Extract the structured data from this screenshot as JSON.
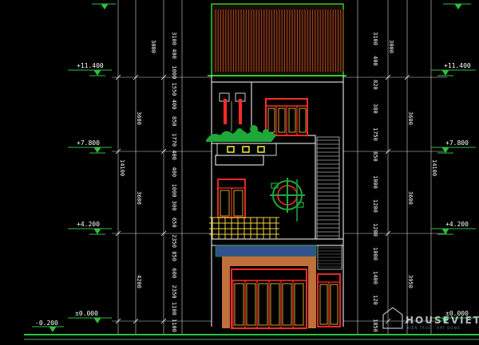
{
  "colors": {
    "background": "#000000",
    "level_line": "#2fbf3f",
    "dimension_line": "#cfcfcf",
    "wall": "#ffffff",
    "roof": "#b0431f",
    "door_frame": "#ff2a2a",
    "door_glass": "#ffcf3a",
    "brick_panel": "#c0703a",
    "stone_panel": "#3b5fa6",
    "railing": "#f2d23a",
    "planter": "#1fa83a"
  },
  "levels": {
    "left": [
      "+11.400",
      "+7.800",
      "+4.200",
      "±0.000",
      "-0.200"
    ],
    "right": [
      "+11.400",
      "+7.800",
      "+4.200",
      "±0.000"
    ]
  },
  "dims": {
    "left_outer_upper": "3000",
    "left_outer_mid1": "3600",
    "left_outer_mid2": "3600",
    "left_outer_lower": "4200",
    "left_total": "14100",
    "left_inner": [
      "3100",
      "400",
      "1000",
      "1550",
      "400",
      "850",
      "1770",
      "400",
      "400",
      "1000",
      "300",
      "650",
      "2350",
      "850",
      "600",
      "2350",
      "1100",
      "1100"
    ],
    "right_outer_upper": "3000",
    "right_outer_mid1": "3600",
    "right_outer_mid2": "3600",
    "right_outer_lower": "3950",
    "right_total": "14100",
    "right_inner": [
      "3100",
      "400",
      "820",
      "380",
      "1750",
      "850",
      "1000",
      "1200",
      "1200",
      "1000",
      "1400",
      "120",
      "1850"
    ]
  },
  "watermark": {
    "brand": "HOUSEVIET",
    "tagline": "KIẾN TRÚC · XÂY DỰNG"
  }
}
